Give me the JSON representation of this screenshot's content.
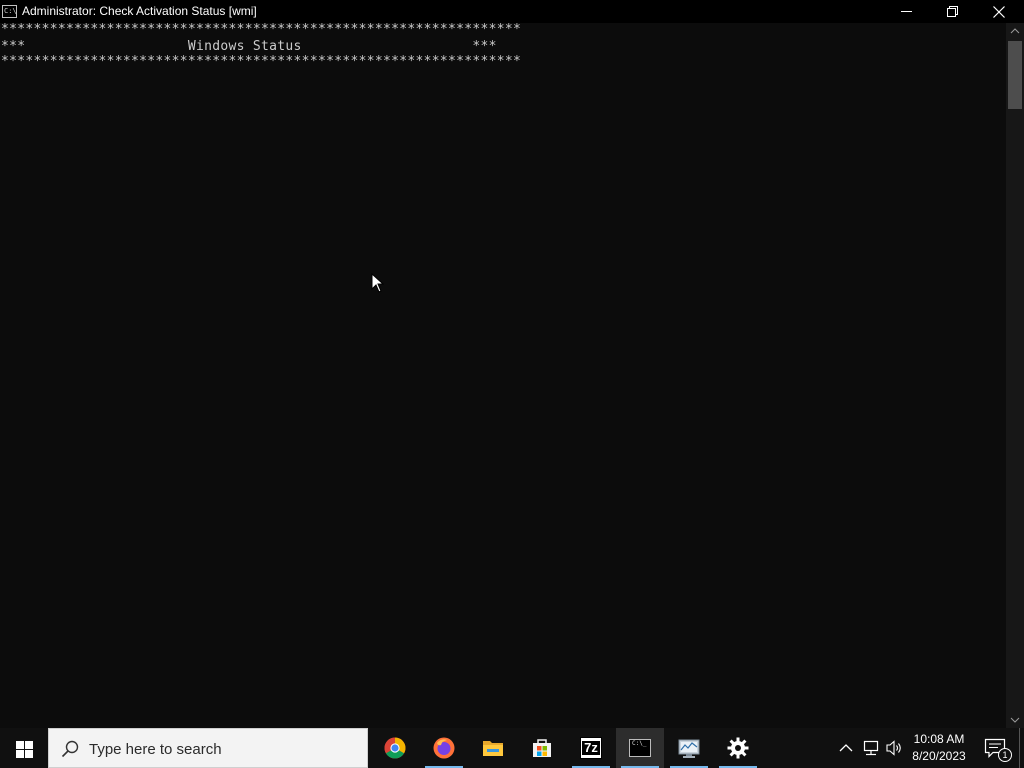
{
  "window": {
    "title": "Administrator:  Check Activation Status [wmi]",
    "icon_text": "C:\\_"
  },
  "console": {
    "line1": "****************************************************************",
    "line2": "***                    Windows Status                     ***",
    "line3": "****************************************************************"
  },
  "taskbar": {
    "search_placeholder": "Type here to search",
    "apps": [
      "chrome-icon",
      "firefox-icon",
      "file-explorer-icon",
      "microsoft-store-icon",
      "7zip-icon",
      "command-prompt-icon",
      "system-monitor-icon",
      "settings-icon"
    ],
    "seven_zip_label": "7z",
    "cmd_label": "C:\\_",
    "clock_time": "10:08 AM",
    "clock_date": "8/20/2023",
    "notification_count": "1"
  },
  "colors": {
    "console_bg": "#0c0c0c",
    "console_text": "#cccccc",
    "taskbar_bg": "#101010",
    "active_indicator": "#76b9ed"
  }
}
